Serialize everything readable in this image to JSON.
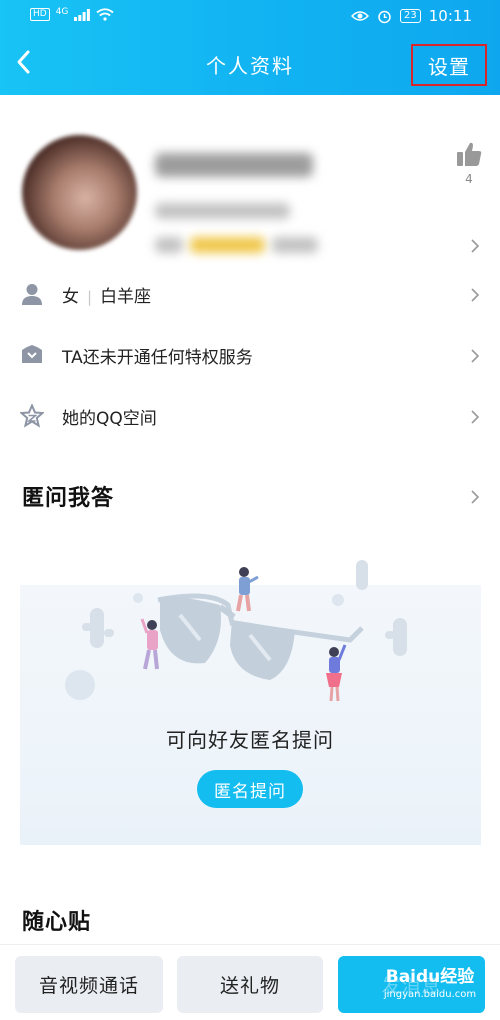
{
  "status_bar": {
    "network_badge": "HD",
    "signal": "4G",
    "battery": "23",
    "time": "10:11"
  },
  "navbar": {
    "title": "个人资料",
    "settings_label": "设置"
  },
  "profile": {
    "like_count": "4"
  },
  "info_rows": [
    {
      "icon": "person-icon",
      "gender": "女",
      "zodiac": "白羊座"
    },
    {
      "icon": "crown-icon",
      "label": "TA还未开通任何特权服务"
    },
    {
      "icon": "star-icon",
      "label": "她的QQ空间"
    }
  ],
  "anonymous_qa": {
    "title": "匿问我答",
    "prompt": "可向好友匿名提问",
    "button_label": "匿名提问"
  },
  "sticky_notes": {
    "title": "随心贴"
  },
  "bottom_bar": {
    "call_label": "音视频通话",
    "gift_label": "送礼物",
    "send_label": "发消息"
  },
  "watermark": {
    "brand": "Baidu经验",
    "url": "jingyan.baidu.com"
  },
  "colors": {
    "header_blue": "#12b4f2",
    "accent_blue": "#14bdf0",
    "highlight_red": "#d9262c"
  }
}
